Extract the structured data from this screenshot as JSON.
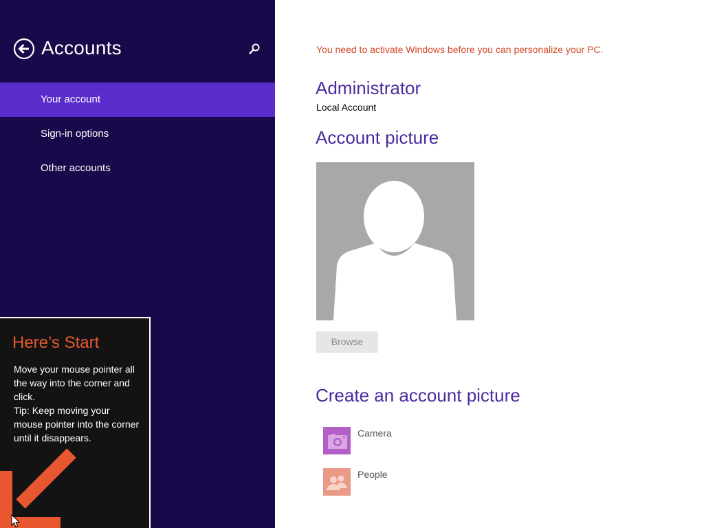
{
  "nav": {
    "title": "Accounts",
    "back_icon": "back-arrow-icon",
    "search_icon": "search-icon",
    "items": [
      {
        "label": "Your account",
        "selected": true
      },
      {
        "label": "Sign-in options",
        "selected": false
      },
      {
        "label": "Other accounts",
        "selected": false
      }
    ]
  },
  "start_tip": {
    "title": "Here’s Start",
    "body_line1": "Move your mouse pointer all the way into the corner and click.",
    "body_line2": "Tip: Keep moving your mouse pointer into the corner until it disappears."
  },
  "content": {
    "activation_warning": "You need to activate Windows before you can personalize your PC.",
    "user_name": "Administrator",
    "account_type": "Local Account",
    "account_picture_heading": "Account picture",
    "browse_label": "Browse",
    "create_heading": "Create an account picture",
    "apps": [
      {
        "label": "Camera",
        "icon": "camera-icon"
      },
      {
        "label": "People",
        "icon": "people-icon"
      }
    ]
  },
  "colors": {
    "nav_background": "#180a4a",
    "nav_selected": "#5a2ccc",
    "heading_purple": "#4b2a9e",
    "warning_orange": "#d24726",
    "tip_accent": "#e8572f",
    "camera_tile": "#b45ec8",
    "people_tile": "#e89a86"
  }
}
